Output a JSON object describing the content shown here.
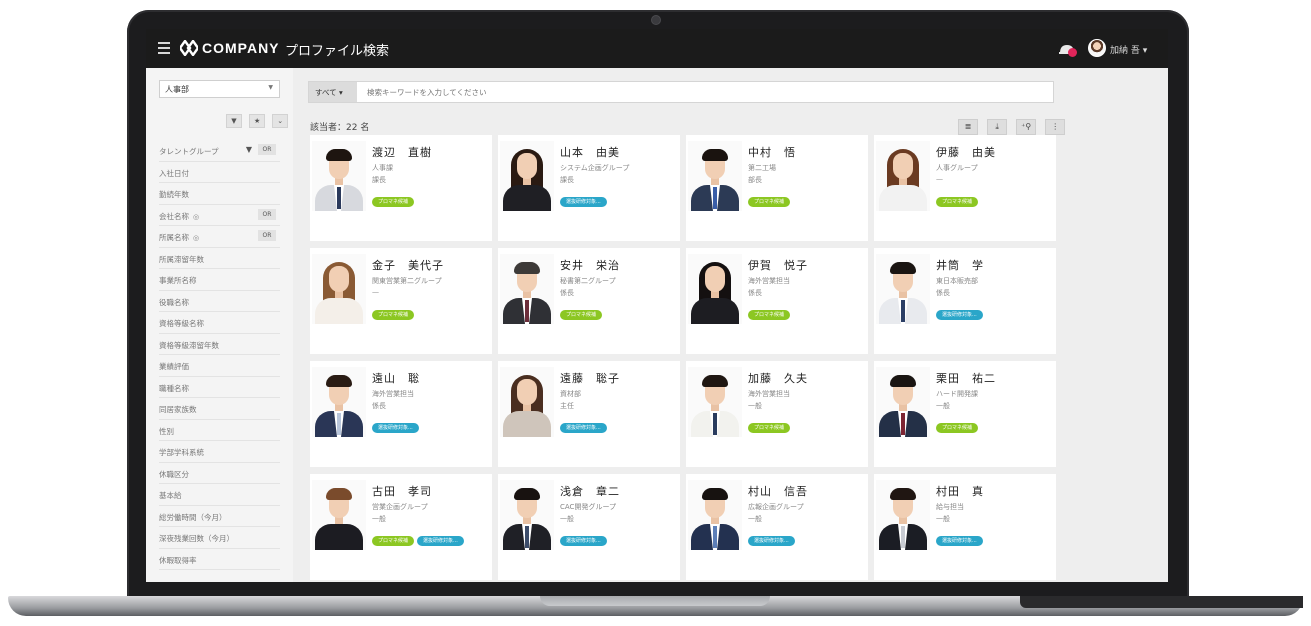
{
  "header": {
    "brand": "COMPANY",
    "title": "プロファイル検索",
    "user_name": "加納 吾"
  },
  "sidebar": {
    "department": "人事部",
    "items": [
      {
        "label": "タレントグループ",
        "filter": "▼",
        "or": "OR"
      },
      {
        "label": "入社日付"
      },
      {
        "label": "勤続年数"
      },
      {
        "label": "会社名称",
        "help": "◎",
        "or": "OR"
      },
      {
        "label": "所属名称",
        "help": "◎",
        "or": "OR"
      },
      {
        "label": "所属滞留年数"
      },
      {
        "label": "事業所名称"
      },
      {
        "label": "役職名称"
      },
      {
        "label": "資格等級名称"
      },
      {
        "label": "資格等級滞留年数"
      },
      {
        "label": "業績評価"
      },
      {
        "label": "職種名称"
      },
      {
        "label": "同居家族数"
      },
      {
        "label": "性別"
      },
      {
        "label": "学部学科系統"
      },
      {
        "label": "休職区分"
      },
      {
        "label": "基本給"
      },
      {
        "label": "総労働時間（今月）"
      },
      {
        "label": "深夜残業回数（今月）"
      },
      {
        "label": "休暇取得率"
      }
    ]
  },
  "search": {
    "scope": "すべて ▾",
    "placeholder": "検索キーワードを入力してください"
  },
  "results": {
    "count_label": "該当者：22 名"
  },
  "people": [
    {
      "name": "渡辺　直樹",
      "dept": "人事課",
      "role": "課長",
      "tags": [
        "プロマネ候補"
      ]
    },
    {
      "name": "山本　由美",
      "dept": "システム企画グループ",
      "role": "課長",
      "tags": [
        "選抜研修対象..."
      ]
    },
    {
      "name": "中村　悟",
      "dept": "第二工場",
      "role": "部長",
      "tags": [
        "プロマネ候補"
      ]
    },
    {
      "name": "伊藤　由美",
      "dept": "人事グループ",
      "role": "—",
      "tags": [
        "プロマネ候補"
      ]
    },
    {
      "name": "金子　美代子",
      "dept": "関東営業第二グループ",
      "role": "—",
      "tags": [
        "プロマネ候補"
      ]
    },
    {
      "name": "安井　栄治",
      "dept": "秘書第二グループ",
      "role": "係長",
      "tags": [
        "プロマネ候補"
      ]
    },
    {
      "name": "伊賀　悦子",
      "dept": "海外営業担当",
      "role": "係長",
      "tags": [
        "プロマネ候補"
      ]
    },
    {
      "name": "井筒　学",
      "dept": "東日本販売部",
      "role": "係長",
      "tags": [
        "選抜研修対象..."
      ]
    },
    {
      "name": "遠山　聡",
      "dept": "海外営業担当",
      "role": "係長",
      "tags": [
        "選抜研修対象..."
      ]
    },
    {
      "name": "遠藤　聡子",
      "dept": "資材部",
      "role": "主任",
      "tags": [
        "選抜研修対象..."
      ]
    },
    {
      "name": "加藤　久夫",
      "dept": "海外営業担当",
      "role": "一般",
      "tags": [
        "プロマネ候補"
      ]
    },
    {
      "name": "栗田　祐二",
      "dept": "ハード開発課",
      "role": "一般",
      "tags": [
        "プロマネ候補"
      ]
    },
    {
      "name": "古田　孝司",
      "dept": "営業企画グループ",
      "role": "一般",
      "tags": [
        "プロマネ候補",
        "選抜研修対象..."
      ]
    },
    {
      "name": "浅倉　章二",
      "dept": "CAC開発グループ",
      "role": "一般",
      "tags": [
        "選抜研修対象..."
      ]
    },
    {
      "name": "村山　信吾",
      "dept": "広報企画グループ",
      "role": "一般",
      "tags": [
        "選抜研修対象..."
      ]
    },
    {
      "name": "村田　真",
      "dept": "給与担当",
      "role": "一般",
      "tags": [
        "選抜研修対象..."
      ]
    }
  ],
  "colors": {
    "topbar": "#1b1b1b",
    "tag_green": "#8cc722",
    "tag_blue": "#2aa6c9",
    "badge": "#e0255a"
  }
}
